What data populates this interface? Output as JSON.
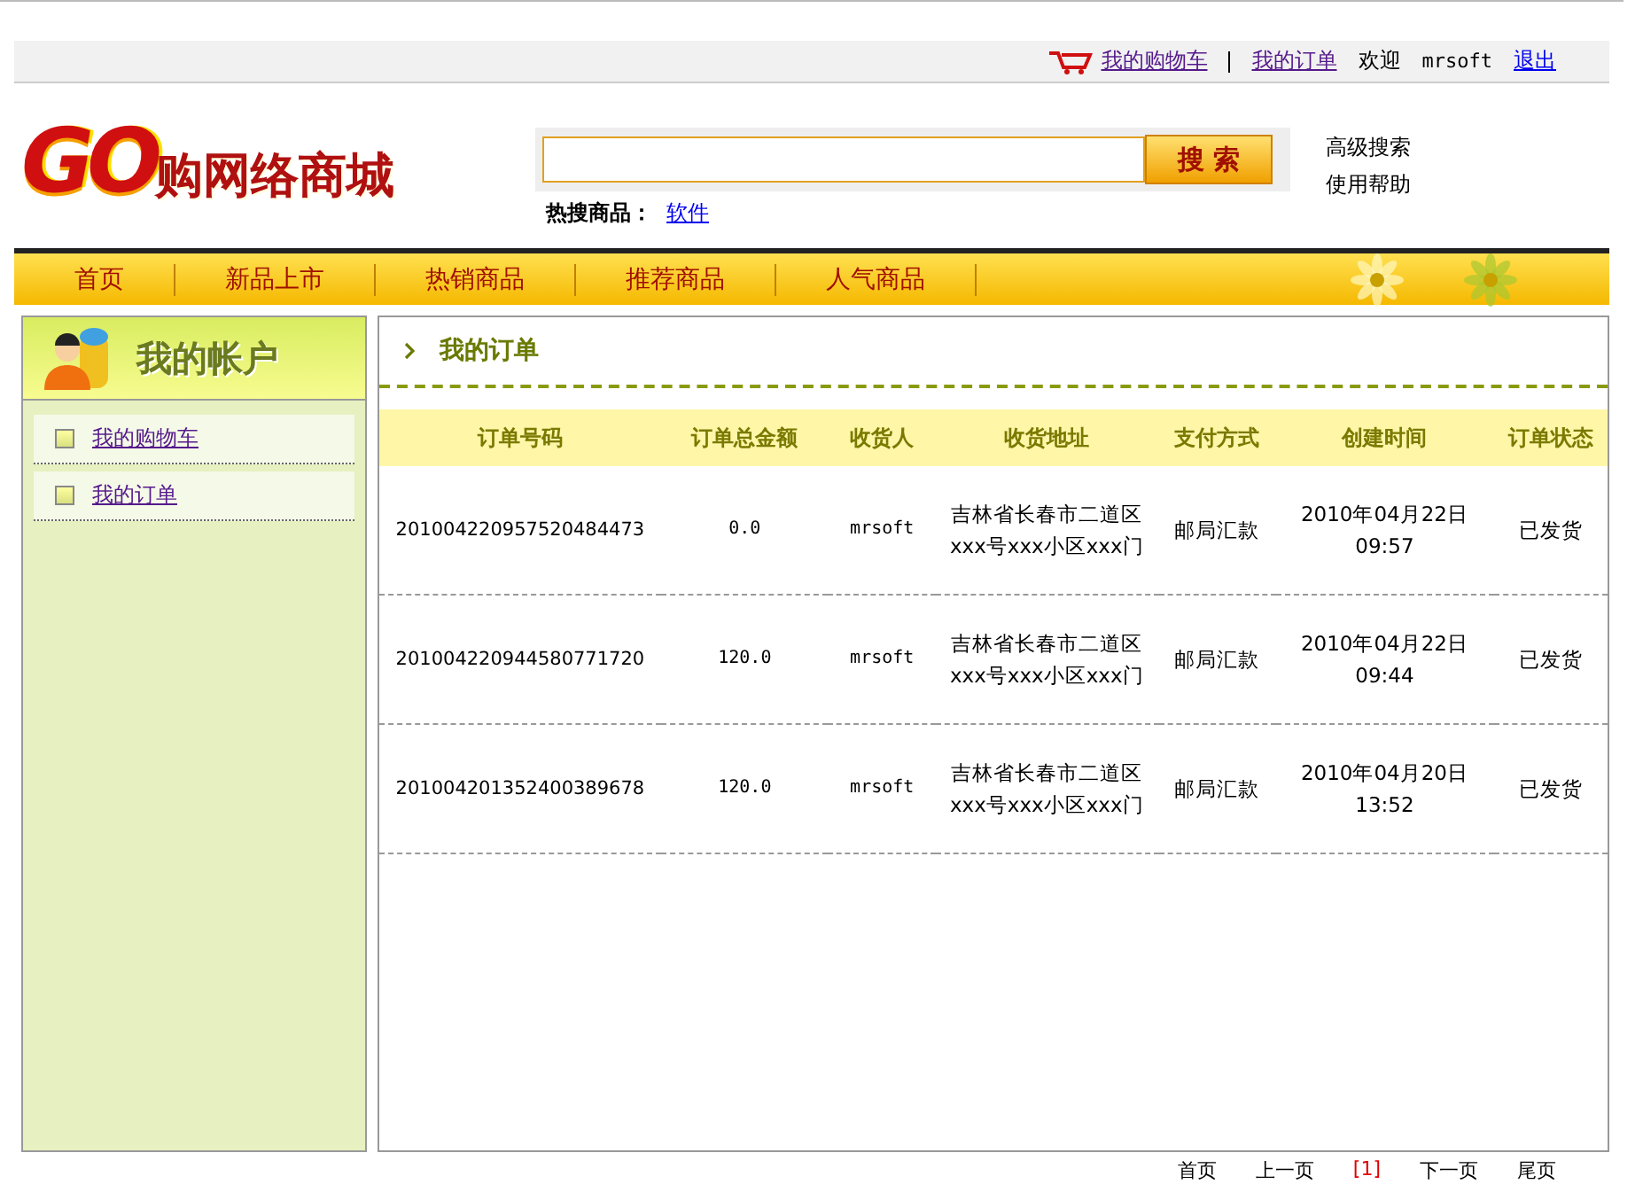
{
  "top_bar": {
    "links": [
      {
        "kind": "cart",
        "label": "我的购物车"
      },
      {
        "kind": "plain",
        "label": "我的订单"
      }
    ],
    "greeting": "欢迎",
    "username": "mrsoft",
    "logout": "退出"
  },
  "logo": {
    "mark": "GO",
    "text": "购网络商城"
  },
  "search": {
    "button": "搜 索",
    "hot_label": "热搜商品：",
    "hot_links": [
      "软件"
    ],
    "links": [
      "高级搜索",
      "使用帮助"
    ]
  },
  "nav": [
    "首页",
    "新品上市",
    "热销商品",
    "推荐商品",
    "人气商品"
  ],
  "sidebar": {
    "title": "我的帐户",
    "items": [
      "我的购物车",
      "我的订单"
    ]
  },
  "content": {
    "title": "我的订单",
    "table": {
      "columns": [
        "订单号码",
        "订单总金额",
        "收货人",
        "收货地址",
        "支付方式",
        "创建时间",
        "订单状态"
      ],
      "rows": [
        {
          "order_no": "201004220957520484473",
          "total": "0.0",
          "receiver": "mrsoft",
          "address": [
            "吉林省长春市二道区",
            "xxx号xxx小区xxx门"
          ],
          "payment": "邮局汇款",
          "created": [
            "2010年04月22日",
            "09:57"
          ],
          "status": "已发货"
        },
        {
          "order_no": "201004220944580771720",
          "total": "120.0",
          "receiver": "mrsoft",
          "address": [
            "吉林省长春市二道区",
            "xxx号xxx小区xxx门"
          ],
          "payment": "邮局汇款",
          "created": [
            "2010年04月22日",
            "09:44"
          ],
          "status": "已发货"
        },
        {
          "order_no": "201004201352400389678",
          "total": "120.0",
          "receiver": "mrsoft",
          "address": [
            "吉林省长春市二道区",
            "xxx号xxx小区xxx门"
          ],
          "payment": "邮局汇款",
          "created": [
            "2010年04月20日",
            "13:52"
          ],
          "status": "已发货"
        }
      ]
    }
  },
  "pagination": {
    "first": "首页",
    "prev": "上一页",
    "current": "[1]",
    "next": "下一页",
    "last": "尾页"
  }
}
